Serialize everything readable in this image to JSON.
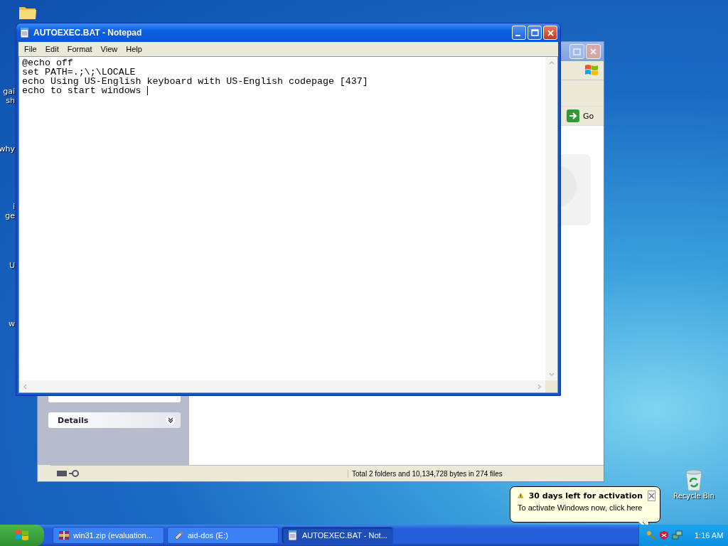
{
  "desktop": {
    "icon_fragments": [
      {
        "label": "gai"
      },
      {
        "label": "sh"
      },
      {
        "label": "why"
      },
      {
        "label": "i"
      },
      {
        "label": "ge"
      },
      {
        "label": "U"
      },
      {
        "label": "w"
      }
    ],
    "recycle_bin": {
      "label": "Recycle Bin"
    }
  },
  "explorer": {
    "left_pane": {
      "details": {
        "label": "Details"
      }
    },
    "address": {
      "go": "Go"
    },
    "status_bar": {
      "text": "Total 2 folders and 10,134,728 bytes in 274 files"
    }
  },
  "notepad": {
    "title": "AUTOEXEC.BAT - Notepad",
    "menu": [
      "File",
      "Edit",
      "Format",
      "View",
      "Help"
    ],
    "lines": [
      "@echo off",
      "set PATH=.;\\;\\LOCALE",
      "echo Using US-English keyboard with US-English codepage [437]",
      "echo to start windows "
    ]
  },
  "balloon": {
    "title": "30 days left for activation",
    "text": "To activate Windows now, click here"
  },
  "taskbar": {
    "tasks": [
      {
        "label": "win31.zip (evaluation...",
        "kind": "archive",
        "selected": false
      },
      {
        "label": "aid-dos (E:)",
        "kind": "drive",
        "selected": false
      },
      {
        "label": "AUTOEXEC.BAT - Not...",
        "kind": "notepad",
        "selected": true
      }
    ],
    "clock": "1:16 AM"
  }
}
